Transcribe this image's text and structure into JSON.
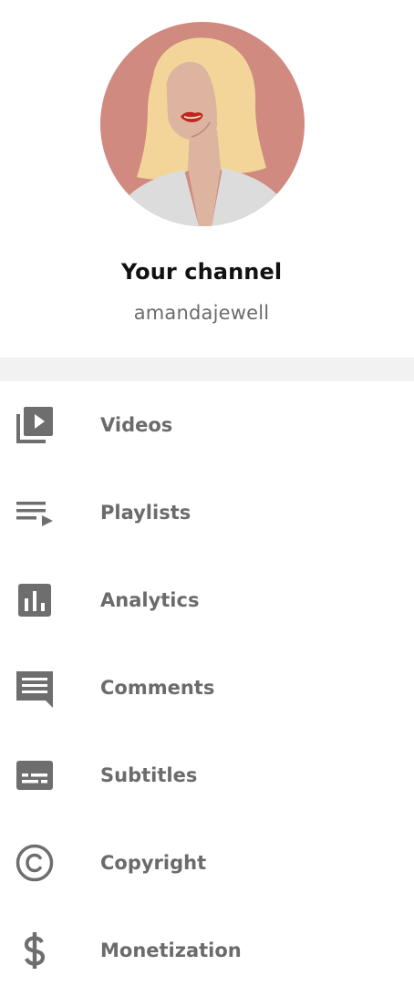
{
  "profile": {
    "title": "Your channel",
    "handle": "amandajewell"
  },
  "menu": {
    "items": [
      {
        "label": "Videos",
        "icon": "video-library-icon"
      },
      {
        "label": "Playlists",
        "icon": "playlist-icon"
      },
      {
        "label": "Analytics",
        "icon": "analytics-icon"
      },
      {
        "label": "Comments",
        "icon": "comment-icon"
      },
      {
        "label": "Subtitles",
        "icon": "subtitles-icon"
      },
      {
        "label": "Copyright",
        "icon": "copyright-icon"
      },
      {
        "label": "Monetization",
        "icon": "dollar-icon"
      }
    ]
  },
  "colors": {
    "avatar_bg": "#d08a80",
    "hair": "#f3d59a",
    "skin": "#dcb49f",
    "shirt": "#d9d9d9",
    "lips": "#c0271b",
    "icon": "#6e6e6e",
    "label": "#6b6b6b",
    "divider": "#f2f2f2"
  }
}
